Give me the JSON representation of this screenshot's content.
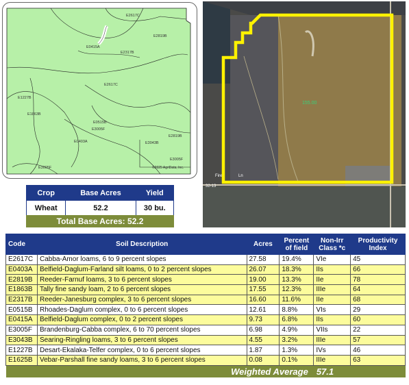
{
  "soil_map": {
    "labels": [
      "E2617C",
      "E2819B",
      "E0415A",
      "E2317B",
      "E1227B",
      "E2617C",
      "E1863B",
      "E0515B",
      "E3005F",
      "E0403A",
      "E3043B",
      "E2819B",
      "E3005F",
      "E3005F"
    ],
    "copyright": "©2025 AgriData, Inc."
  },
  "aerial": {
    "field_label": "155.00",
    "road_label": "Fire",
    "road_label2": "Ln",
    "road_label3": "32-13"
  },
  "crop_table": {
    "headers": [
      "Crop",
      "Base Acres",
      "Yield"
    ],
    "rows": [
      [
        "Wheat",
        "52.2",
        "30 bu."
      ]
    ],
    "total_label": "Total Base Acres:",
    "total_value": "52.2"
  },
  "soil_table": {
    "headers": {
      "code": "Code",
      "desc": "Soil Description",
      "acres": "Acres",
      "pct1": "Percent",
      "pct2": "of field",
      "cls1": "Non-Irr",
      "cls2": "Class *c",
      "pi1": "Productivity",
      "pi2": "Index"
    },
    "rows": [
      [
        "E2617C",
        "Cabba-Amor loams, 6 to 9 percent slopes",
        "27.58",
        "19.4%",
        "VIe",
        "45"
      ],
      [
        "E0403A",
        "Belfield-Daglum-Farland silt loams, 0 to 2 percent slopes",
        "26.07",
        "18.3%",
        "IIs",
        "66"
      ],
      [
        "E2819B",
        "Reeder-Farnuf loams, 3 to 6 percent slopes",
        "19.00",
        "13.3%",
        "IIe",
        "78"
      ],
      [
        "E1863B",
        "Tally fine sandy loam, 2 to 6 percent slopes",
        "17.55",
        "12.3%",
        "IIIe",
        "64"
      ],
      [
        "E2317B",
        "Reeder-Janesburg complex, 3 to 6 percent slopes",
        "16.60",
        "11.6%",
        "IIe",
        "68"
      ],
      [
        "E0515B",
        "Rhoades-Daglum complex, 0 to 6 percent slopes",
        "12.61",
        "8.8%",
        "VIs",
        "29"
      ],
      [
        "E0415A",
        "Belfield-Daglum complex, 0 to 2 percent slopes",
        "9.73",
        "6.8%",
        "IIs",
        "60"
      ],
      [
        "E3005F",
        "Brandenburg-Cabba complex, 6 to 70 percent slopes",
        "6.98",
        "4.9%",
        "VIIs",
        "22"
      ],
      [
        "E3043B",
        "Searing-Ringling loams, 3 to 6 percent slopes",
        "4.55",
        "3.2%",
        "IIIe",
        "57"
      ],
      [
        "E1227B",
        "Desart-Ekalaka-Telfer complex, 0 to 6 percent slopes",
        "1.87",
        "1.3%",
        "IVs",
        "46"
      ],
      [
        "E1625B",
        "Vebar-Parshall fine sandy loams, 3 to 6 percent slopes",
        "0.08",
        "0.1%",
        "IIIe",
        "63"
      ]
    ],
    "weighted_label": "Weighted Average",
    "weighted_value": "57.1"
  },
  "colors": {
    "header_blue": "#1f3a8a",
    "row_yellow": "#fcfc9c",
    "olive": "#7d8c3a",
    "map_green": "#b7f0a8",
    "field_outline": "#ffee00"
  }
}
